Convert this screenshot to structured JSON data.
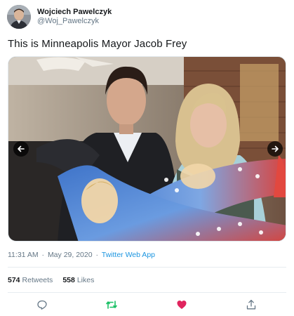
{
  "author": {
    "display_name": "Wojciech Pawelczyk",
    "handle": "@Woj_Pawelczyk",
    "avatar_icon": "profile-photo"
  },
  "tweet": {
    "text": "This is Minneapolis Mayor Jacob Frey"
  },
  "media": {
    "type": "photo",
    "prev_icon": "arrow-left-icon",
    "next_icon": "arrow-right-icon"
  },
  "meta": {
    "time": "11:31 AM",
    "separator": "·",
    "date": "May 29, 2020",
    "source": "Twitter Web App"
  },
  "stats": {
    "retweets_count": "574",
    "retweets_label": "Retweets",
    "likes_count": "558",
    "likes_label": "Likes"
  },
  "actions": {
    "reply_icon": "reply-icon",
    "retweet_icon": "retweet-icon",
    "like_icon": "heart-icon",
    "share_icon": "share-icon",
    "retweet_color": "#17bf63",
    "like_color": "#e0245e",
    "neutral_color": "#657786"
  },
  "colors": {
    "link": "#1b95e0",
    "text": "#14171a",
    "secondary": "#657786"
  }
}
